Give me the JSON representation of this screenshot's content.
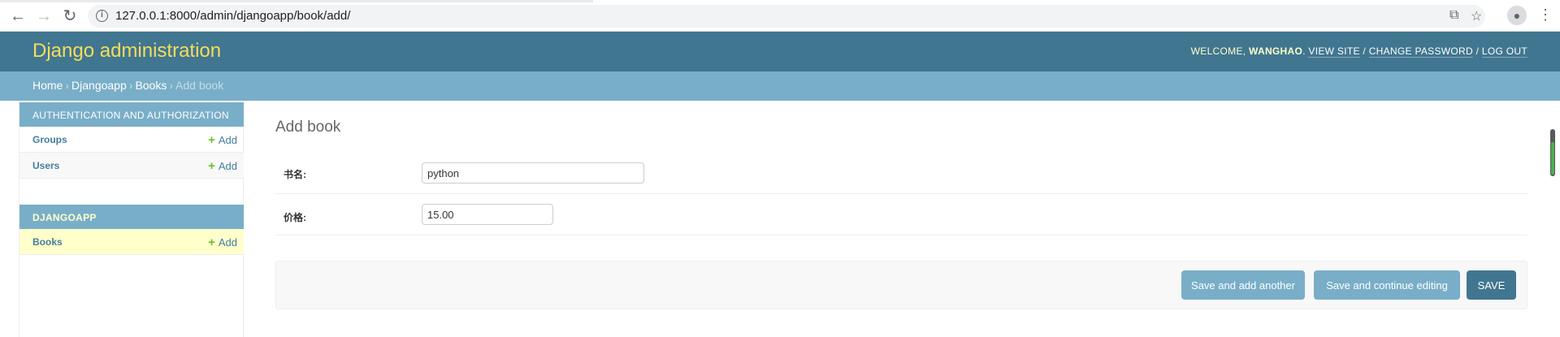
{
  "browser": {
    "url": "127.0.0.1:8000/admin/djangoapp/book/add/",
    "icons": [
      "back-icon",
      "forward-icon",
      "reload-icon",
      "info-icon",
      "translate-icon",
      "star-icon",
      "profile-icon",
      "menu-icon"
    ]
  },
  "header": {
    "brand": "Django administration",
    "welcome": "WELCOME, ",
    "username": "WANGHAO",
    "period": ". ",
    "view_site": "VIEW SITE",
    "change_password": "CHANGE PASSWORD",
    "log_out": "LOG OUT",
    "sep": " / "
  },
  "breadcrumbs": {
    "items": [
      "Home",
      "Djangoapp",
      "Books"
    ],
    "current": "Add book",
    "sep": "›"
  },
  "sidebar": {
    "modules": [
      {
        "caption": "AUTHENTICATION AND AUTHORIZATION",
        "rows": [
          {
            "label": "Groups",
            "add": "Add"
          },
          {
            "label": "Users",
            "add": "Add"
          }
        ]
      },
      {
        "caption": "DJANGOAPP",
        "rows": [
          {
            "label": "Books",
            "add": "Add"
          }
        ]
      }
    ]
  },
  "main": {
    "title": "Add book",
    "fields": [
      {
        "label": "书名:",
        "value": "python"
      },
      {
        "label": "价格:",
        "value": "15.00"
      }
    ],
    "buttons": {
      "save_add_another": "Save and add another",
      "save_continue": "Save and continue editing",
      "save": "SAVE"
    }
  },
  "colors": {
    "header": "#417690",
    "breadcrumb": "#79aec8",
    "brand": "#f5dd5d",
    "selected_row": "#ffffcc",
    "add_icon": "#70bf2b"
  }
}
